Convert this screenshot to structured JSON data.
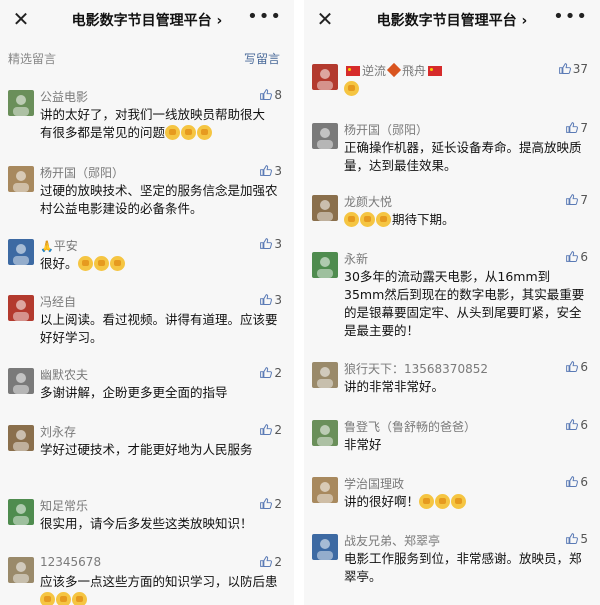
{
  "left": {
    "title": "电影数字节目管理平台",
    "selected_label": "精选留言",
    "write_label": "写留言",
    "comments": [
      {
        "name": "公益电影",
        "likes": "8",
        "text": "讲的太好了，对我们一线放映员帮助很大 有很多都是常见的问题",
        "emoji_count": 3
      },
      {
        "name": "杨开国（郧阳）",
        "likes": "3",
        "text": "过硬的放映技术、坚定的服务信念是加强农村公益电影建设的必备条件。",
        "emoji_count": 0
      },
      {
        "name": "平安",
        "likes": "3",
        "text": "很好。",
        "emoji_count": 3
      },
      {
        "name": "冯经自",
        "likes": "3",
        "text": "以上阅读。看过视频。讲得有道理。应该要好好学习。",
        "emoji_count": 0
      },
      {
        "name": "幽默农夫",
        "likes": "2",
        "text": "多谢讲解，企盼更多更全面的指导",
        "emoji_count": 0
      },
      {
        "name": "刘永存",
        "likes": "2",
        "text": "学好过硬技术，才能更好地为人民服务",
        "emoji_count": 0
      },
      {
        "name": "知足常乐",
        "likes": "2",
        "text": "很实用，请今后多发些这类放映知识！",
        "emoji_count": 0
      },
      {
        "name": "12345678",
        "likes": "2",
        "text": "应该多一点这些方面的知识学习，以防后患",
        "emoji_count": 3
      }
    ]
  },
  "right": {
    "title": "电影数字节目管理平台",
    "comments": [
      {
        "name_a": "逆流",
        "name_b": "飛舟",
        "likes": "37",
        "text": "",
        "emoji_count": 1
      },
      {
        "name": "杨开国（郧阳）",
        "likes": "7",
        "text": "正确操作机器，延长设备寿命。提高放映质量，达到最佳效果。",
        "emoji_count": 0
      },
      {
        "name": "龙颜大悦",
        "likes": "7",
        "text": "期待下期。",
        "emoji_count": 3
      },
      {
        "name": "永新",
        "likes": "6",
        "text": "30多年的流动露天电影，从16mm到35mm然后到现在的数字电影，其实最重要的是银幕要固定牢、从头到尾要盯紧，安全是最主要的！",
        "emoji_count": 0
      },
      {
        "name": "狼行天下：13568370852",
        "likes": "6",
        "text": "讲的非常非常好。",
        "emoji_count": 0
      },
      {
        "name": "鲁登飞（鲁舒畅的爸爸）",
        "likes": "6",
        "text": "非常好",
        "emoji_count": 0
      },
      {
        "name": "学治国理政",
        "likes": "6",
        "text": "讲的很好啊！",
        "emoji_count": 3
      },
      {
        "name": "战友兄弟、郑翠亭",
        "likes": "5",
        "text": "电影工作服务到位，非常感谢。放映员，郑翠亭。",
        "emoji_count": 0
      }
    ]
  }
}
